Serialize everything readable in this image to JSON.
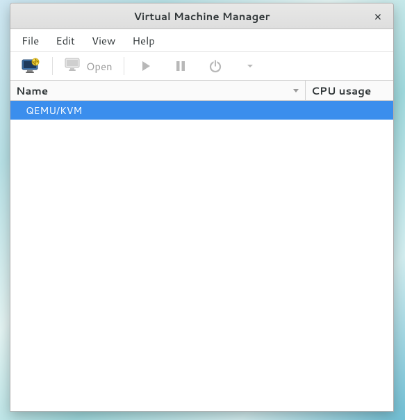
{
  "window": {
    "title": "Virtual Machine Manager",
    "close_glyph": "×"
  },
  "menubar": {
    "file": "File",
    "edit": "Edit",
    "view": "View",
    "help": "Help"
  },
  "toolbar": {
    "open_label": "Open"
  },
  "columns": {
    "name": "Name",
    "cpu": "CPU usage"
  },
  "rows": [
    {
      "label": "QEMU/KVM",
      "selected": true
    }
  ]
}
